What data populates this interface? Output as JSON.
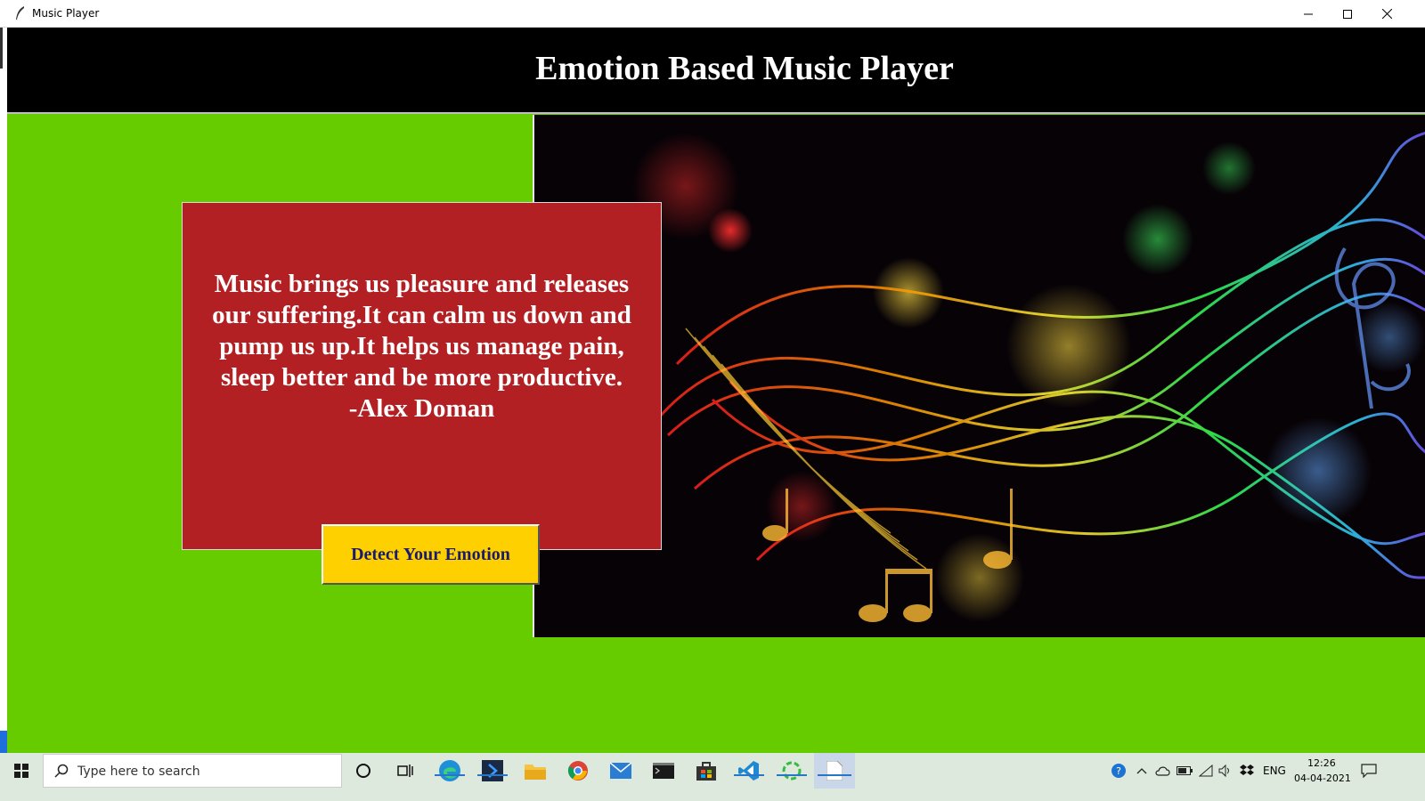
{
  "window": {
    "title": "Music Player",
    "controls": [
      "minimize-icon",
      "maximize-icon",
      "close-icon"
    ]
  },
  "header": {
    "title": "Emotion Based Music Player"
  },
  "quote": {
    "text": "Music brings us pleasure and releases\nour suffering.It can calm us down and\npump us up.It helps us manage pain,\nsleep better and be more productive.\n-Alex Doman"
  },
  "detect_button": {
    "label": "Detect Your Emotion"
  },
  "taskbar": {
    "search_placeholder": "Type here to search",
    "apps": [
      "cortana-icon",
      "task-view-icon",
      "edge-icon",
      "pycharm-icon",
      "file-explorer-icon",
      "chrome-icon",
      "mail-icon",
      "terminal-icon",
      "store-icon",
      "vscode-icon",
      "python-loading-icon",
      "document-icon"
    ],
    "tray": {
      "language": "ENG",
      "time": "12:26",
      "date": "04-04-2021"
    }
  },
  "colors": {
    "background": "#66cc00",
    "header": "#000000",
    "quote_box": "#b22024",
    "button": "#ffd000",
    "button_text": "#1a1a6e"
  }
}
